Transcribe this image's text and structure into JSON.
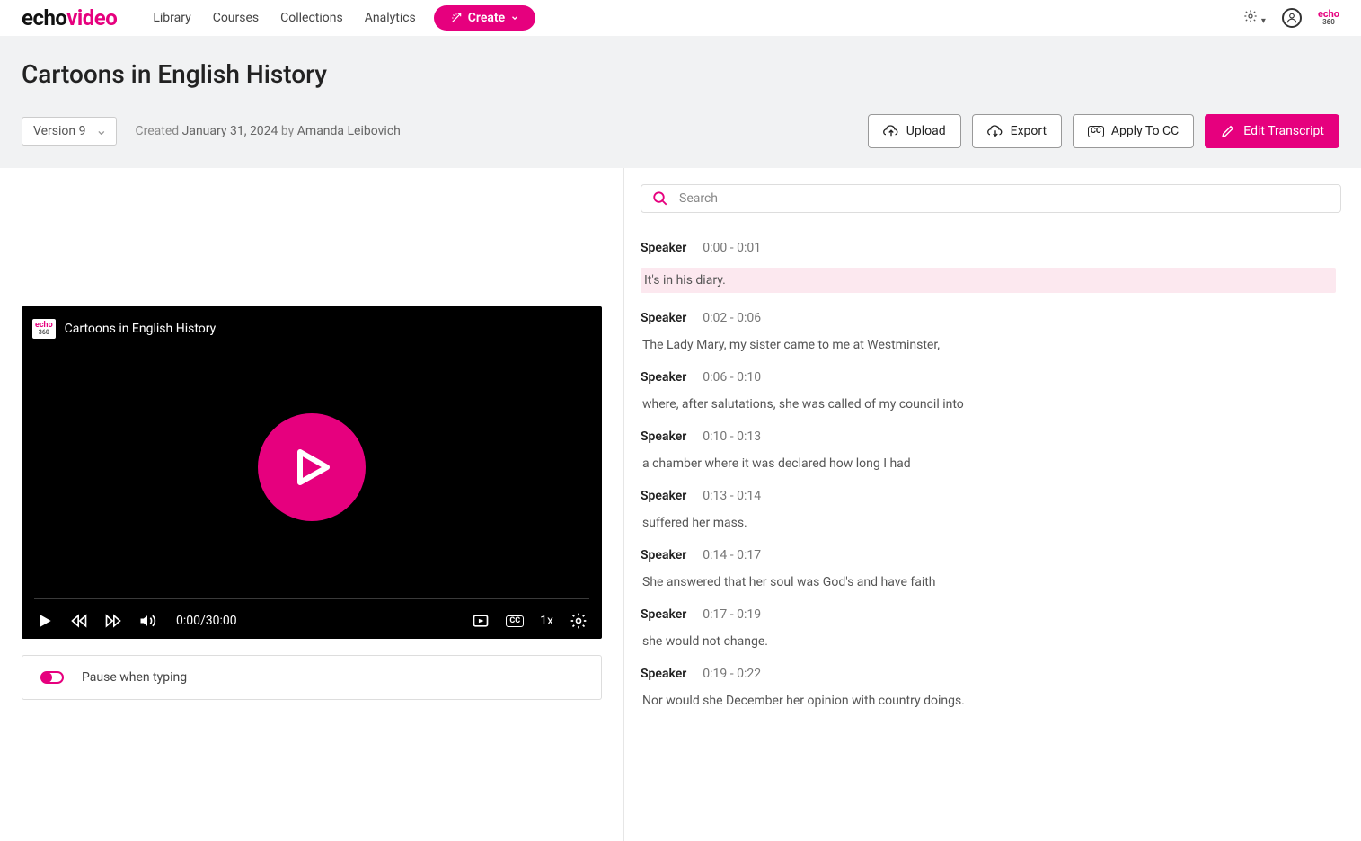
{
  "brand": {
    "part1": "echo",
    "part2": "video",
    "small1": "echo",
    "small2": "360"
  },
  "nav": {
    "library": "Library",
    "courses": "Courses",
    "collections": "Collections",
    "analytics": "Analytics",
    "create": "Create"
  },
  "page": {
    "title": "Cartoons in English History",
    "version_label": "Version 9",
    "created_prefix": "Created ",
    "created_date": "January 31, 2024",
    "by": " by ",
    "author": "Amanda Leibovich"
  },
  "actions": {
    "upload": "Upload",
    "export_": "Export",
    "apply_cc": "Apply To CC",
    "edit_transcript": "Edit Transcript"
  },
  "player": {
    "title": "Cartoons in English History",
    "time": "0:00/30:00",
    "speed": "1x",
    "cc_label": "CC",
    "badge1": "echo",
    "badge2": "360"
  },
  "pause_typing_label": "Pause when typing",
  "search": {
    "placeholder": "Search"
  },
  "transcript": [
    {
      "speaker": "Speaker",
      "ts": "0:00 - 0:01",
      "text": "It's in his diary.",
      "highlight": true
    },
    {
      "speaker": "Speaker",
      "ts": "0:02 - 0:06",
      "text": "The Lady Mary, my sister came to me at Westminster,"
    },
    {
      "speaker": "Speaker",
      "ts": "0:06 - 0:10",
      "text": "where, after salutations, she was called of my council into"
    },
    {
      "speaker": "Speaker",
      "ts": "0:10 - 0:13",
      "text": "a chamber where it was declared how long I had"
    },
    {
      "speaker": "Speaker",
      "ts": "0:13 - 0:14",
      "text": "suffered her mass."
    },
    {
      "speaker": "Speaker",
      "ts": "0:14 - 0:17",
      "text": "She answered that her soul was God's and have faith"
    },
    {
      "speaker": "Speaker",
      "ts": "0:17 - 0:19",
      "text": "she would not change."
    },
    {
      "speaker": "Speaker",
      "ts": "0:19 - 0:22",
      "text": "Nor would she December her opinion with country doings."
    }
  ]
}
